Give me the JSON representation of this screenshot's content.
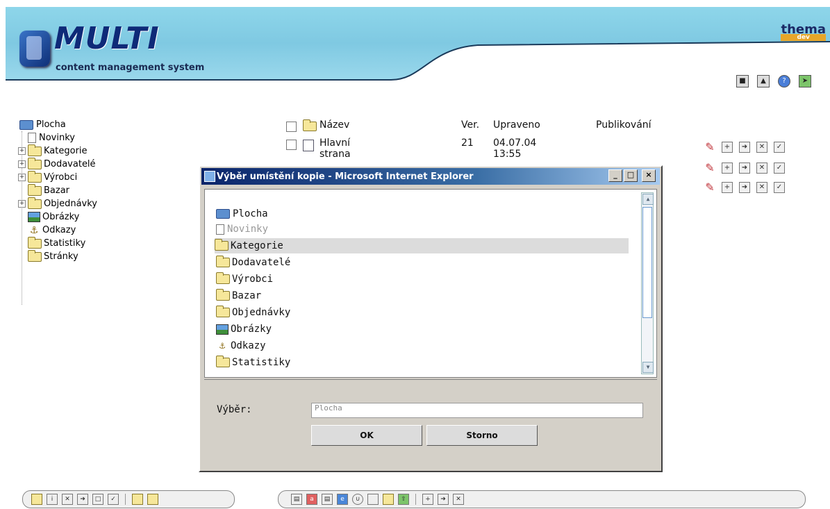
{
  "header": {
    "logo_title": "MULTI",
    "logo_subtitle": "content management system",
    "brand_top": "thema",
    "brand_bottom": "dev"
  },
  "tree": {
    "items": [
      {
        "label": "Plocha",
        "icon": "desktop-icon"
      },
      {
        "label": "Novinky",
        "icon": "document-icon"
      },
      {
        "label": "Kategorie",
        "icon": "folder-icon"
      },
      {
        "label": "Dodavatelé",
        "icon": "folder-icon"
      },
      {
        "label": "Výrobci",
        "icon": "folder-icon"
      },
      {
        "label": "Bazar",
        "icon": "folder-icon"
      },
      {
        "label": "Objednávky",
        "icon": "folder-icon"
      },
      {
        "label": "Obrázky",
        "icon": "image-icon"
      },
      {
        "label": "Odkazy",
        "icon": "anchor-icon"
      },
      {
        "label": "Statistiky",
        "icon": "folder-icon"
      },
      {
        "label": "Stránky",
        "icon": "folder-icon"
      }
    ]
  },
  "list": {
    "headers": {
      "name": "Název",
      "ver": "Ver.",
      "modified": "Upraveno",
      "published": "Publikování"
    },
    "rows": [
      {
        "name": "Hlavní strana",
        "ver": "21",
        "modified": "04.07.04 13:55",
        "published": ""
      }
    ]
  },
  "dialog": {
    "title": "Výběr umístění kopie - Microsoft Internet Explorer",
    "items": [
      {
        "label": "Plocha",
        "icon": "desktop-icon"
      },
      {
        "label": "Novinky",
        "icon": "document-icon"
      },
      {
        "label": "Kategorie",
        "icon": "folder-icon"
      },
      {
        "label": "Dodavatelé",
        "icon": "folder-icon"
      },
      {
        "label": "Výrobci",
        "icon": "folder-icon"
      },
      {
        "label": "Bazar",
        "icon": "folder-icon"
      },
      {
        "label": "Objednávky",
        "icon": "folder-icon"
      },
      {
        "label": "Obrázky",
        "icon": "image-icon"
      },
      {
        "label": "Odkazy",
        "icon": "anchor-icon"
      },
      {
        "label": "Statistiky",
        "icon": "folder-icon"
      }
    ],
    "selected_item": "Kategorie",
    "disabled_item": "Novinky",
    "selection_label": "Výběr:",
    "selection_value": "Plocha",
    "ok_label": "OK",
    "cancel_label": "Storno",
    "minimize": "_",
    "maximize": "□",
    "close": "×"
  },
  "colors": {
    "header_blue": "#8ed6ea",
    "title_bar": "#0a246a",
    "selection": "#dcdcdc"
  }
}
